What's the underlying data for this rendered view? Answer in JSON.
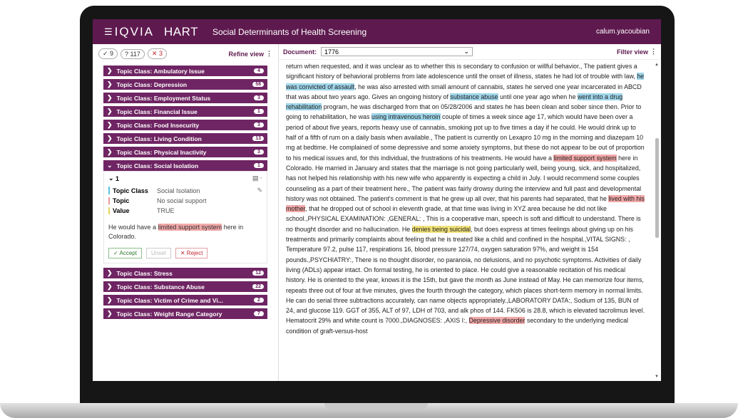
{
  "app": {
    "brand": "IQVIA",
    "product": "HART",
    "title": "Social Determinants of Health Screening",
    "user": "calum.yacoubian"
  },
  "filters": {
    "accepted": "✓ 9",
    "unknown": "? 117",
    "rejected": "✕ 3",
    "refine_label": "Refine view"
  },
  "topics_before": [
    {
      "label": "Topic Class: Ambulatory Issue",
      "count": "4"
    },
    {
      "label": "Topic Class: Depression",
      "count": "58"
    },
    {
      "label": "Topic Class: Employment Status",
      "count": "3"
    },
    {
      "label": "Topic Class: Financial Issue",
      "count": "1"
    },
    {
      "label": "Topic Class: Food Insecurity",
      "count": "3"
    },
    {
      "label": "Topic Class: Living Condition",
      "count": "13"
    },
    {
      "label": "Topic Class: Physical Inactivity",
      "count": "3"
    }
  ],
  "expanded_topic": {
    "label": "Topic Class: Social Isolation",
    "count": "1"
  },
  "detail": {
    "index": "1",
    "rows": [
      {
        "key": "Topic Class",
        "value": "Social Isolation"
      },
      {
        "key": "Topic",
        "value": "No social support"
      },
      {
        "key": "Value",
        "value": "TRUE"
      }
    ],
    "snippet_pre": "He would have a ",
    "snippet_hl": "limited support system",
    "snippet_post": " here in Colorado.",
    "accept": "✓ Accept",
    "unset": "Unset",
    "reject": "✕ Reject"
  },
  "topics_after": [
    {
      "label": "Topic Class: Stress",
      "count": "12"
    },
    {
      "label": "Topic Class: Substance Abuse",
      "count": "22"
    },
    {
      "label": "Topic Class: Victim of Crime and Vi...",
      "count": "2"
    },
    {
      "label": "Topic Class: Weight Range Category",
      "count": "7"
    }
  ],
  "document": {
    "label": "Document:",
    "selected": "1776",
    "filter_label": "Filter view",
    "segments": [
      {
        "t": "return when requested, and it was unclear as to whether this is secondary to confusion or willful behavior., The patient gives a significant history of behavioral problems from late adolescence until the onset of illness, states he had lot of trouble with law, ",
        "h": ""
      },
      {
        "t": "he was convicted of assault",
        "h": "blue"
      },
      {
        "t": ", he was also arrested with small amount of cannabis, states he served one year incarcerated in ABCD that was about two years ago. Gives an ongoing history of ",
        "h": ""
      },
      {
        "t": "substance abuse",
        "h": "blue"
      },
      {
        "t": " until one year ago when he ",
        "h": ""
      },
      {
        "t": "went into a drug rehabilitation",
        "h": "blue"
      },
      {
        "t": " program, he was discharged from that on 05/28/2006 and states he has been clean and sober since then. Prior to going to rehabilitation, he was ",
        "h": ""
      },
      {
        "t": "using intravenous heroin",
        "h": "blue"
      },
      {
        "t": " couple of times a week since age 17, which would have been over a period of about five years, reports heavy use of cannabis, smoking pot up to five times a day if he could. He would drink up to half of a fifth of rum on a daily basis when available., The patient is currently on Lexapro 10 mg in the morning and diazepam 10 mg at bedtime. He complained of some depressive and some anxiety symptoms, but these do not appear to be out of proportion to his medical issues and, for this individual, the frustrations of his treatments. He would have a ",
        "h": ""
      },
      {
        "t": "limited support system",
        "h": "red"
      },
      {
        "t": " here in Colorado. He married in January and states that the marriage is not going particularly well, being young, sick, and hospitalized, has not helped his relationship with his new wife who apparently is expecting a child in July. I would recommend some couples counseling as a part of their treatment here., The patient was fairly drowsy during the interview and full past and developmental history was not obtained. The patient's comment is that he grew up all over, that his parents had separated, that he ",
        "h": ""
      },
      {
        "t": "lived with his mother",
        "h": "red"
      },
      {
        "t": ", that he dropped out of school in eleventh grade, at that time was living in XYZ area because he did not like school.,PHYSICAL EXAMINATION: ,GENERAL: , This is a cooperative man, speech is soft and difficult to understand. There is no thought disorder and no hallucination. He ",
        "h": ""
      },
      {
        "t": "denies being suicidal",
        "h": "yellow"
      },
      {
        "t": ", but does express at times feelings about giving up on his treatments and primarily complaints about feeling that he is treated like a child and confined in the hospital.,VITAL SIGNS: , Temperature 97.2, pulse 117, respirations 16, blood pressure 127/74, oxygen saturation 97%, and weight is 154 pounds.,PSYCHIATRY:, There is no thought disorder, no paranoia, no delusions, and no psychotic symptoms. Activities of daily living (ADLs) appear intact. On formal testing, he is oriented to place. He could give a reasonable recitation of his medical history. He is oriented to the year, knows it is the 15th, but gave the month as June instead of May. He can memorize four items, repeats three out of four at five minutes, gives the fourth through the category, which places short-term memory in normal limits. He can do serial three subtractions accurately, can name objects appropriately.,LABORATORY DATA:, Sodium of 135, BUN of 24, and glucose 119. GGT of 355, ALT of 97, LDH of 703, and alk phos of 144. FK506 is 28.8, which is elevated tacrolimus level. Hematocrit 29% and white count is 7000.,DIAGNOSES: ,AXIS I:, ",
        "h": ""
      },
      {
        "t": "Depressive disorder",
        "h": "red"
      },
      {
        "t": " secondary to the underlying medical condition of graft-versus-host",
        "h": ""
      }
    ]
  }
}
